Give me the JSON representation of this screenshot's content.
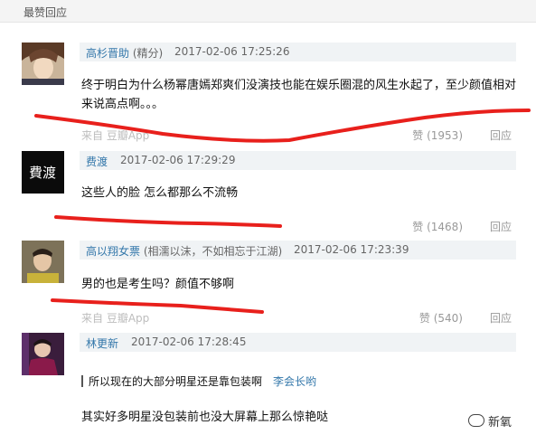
{
  "section": {
    "title": "最赞回应"
  },
  "comments": [
    {
      "user": "高杉晋助",
      "tag": "(精分)",
      "time": "2017-02-06 17:25:26",
      "text": "终于明白为什么杨幂唐嫣郑爽们没演技也能在娱乐圈混的风生水起了，至少颜值相对来说高点啊。。。",
      "source": "来自 豆瓣App",
      "votes": "赞 (1953)",
      "reply": "回应"
    },
    {
      "user": "费渡",
      "time": "2017-02-06 17:29:29",
      "text": "这些人的脸 怎么都那么不流畅",
      "votes": "赞 (1468)",
      "reply": "回应"
    },
    {
      "user": "高以翔女票",
      "tag": "(相濡以沫，不如相忘于江湖)",
      "time": "2017-02-06 17:23:39",
      "text": "男的也是考生吗？颜值不够啊",
      "source": "来自 豆瓣App",
      "votes": "赞 (540)",
      "reply": "回应"
    },
    {
      "user": "林更新",
      "time": "2017-02-06 17:28:45",
      "quote": "所以现在的大部分明星还是靠包装啊",
      "quote_author": "李会长哟",
      "text": "其实好多明星没包装前也没大屏幕上那么惊艳哒"
    }
  ],
  "watermark": "新氧",
  "colors": {
    "link": "#3377aa",
    "meta_bg": "#f0f3f5",
    "marker": "#e8201c"
  }
}
